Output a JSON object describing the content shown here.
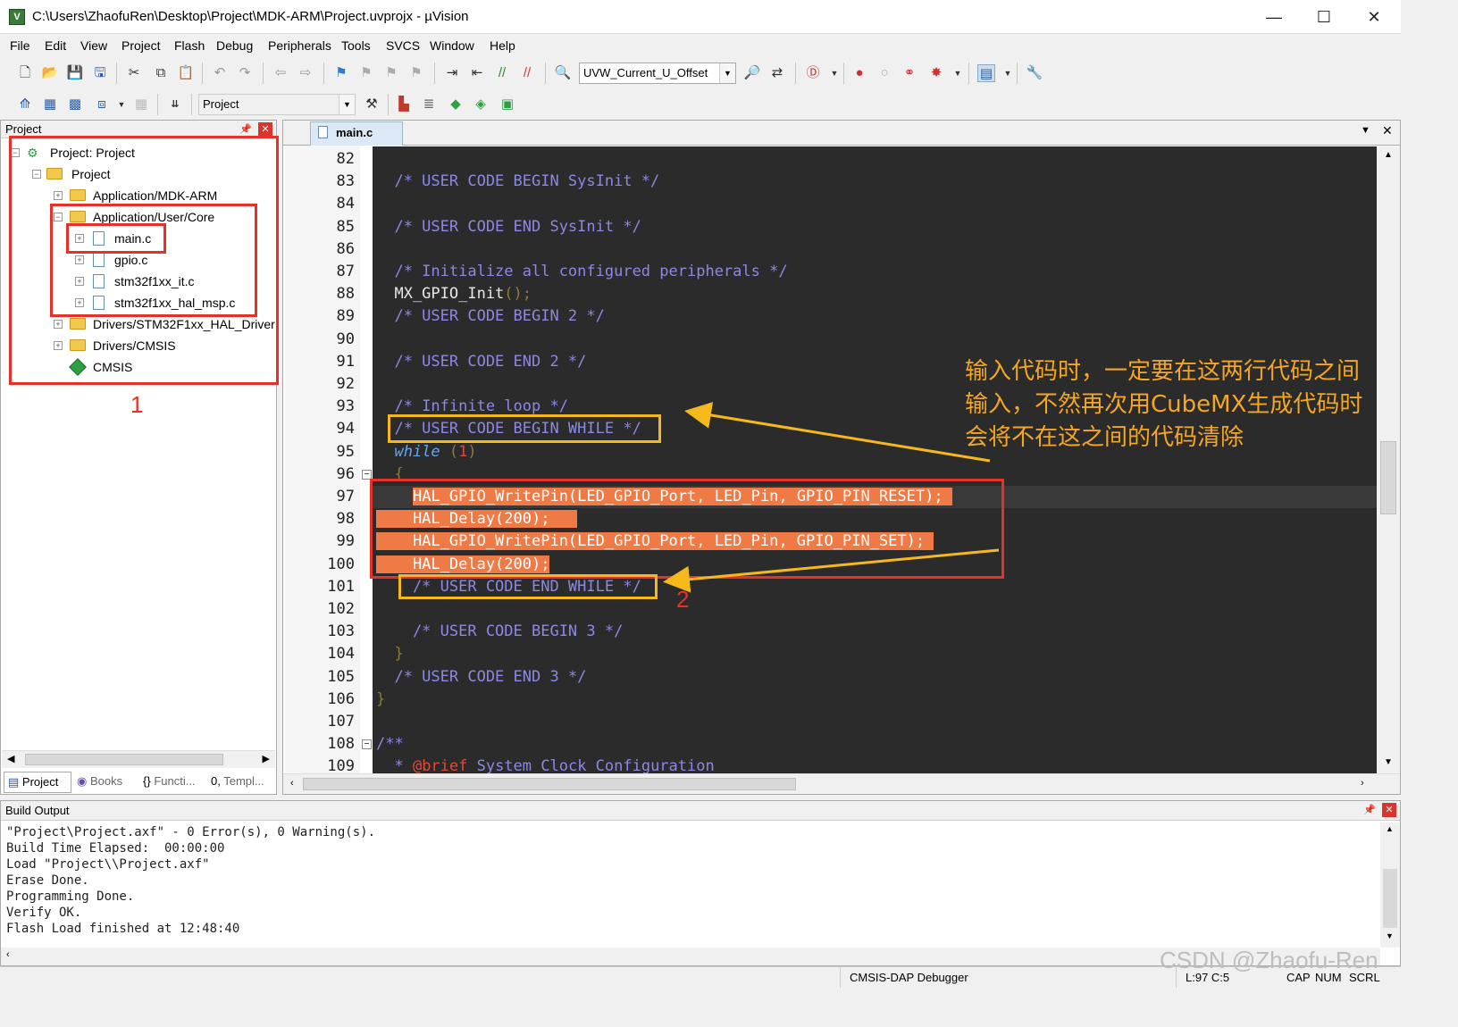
{
  "window": {
    "title": "C:\\Users\\ZhaofuRen\\Desktop\\Project\\MDK-ARM\\Project.uvprojx - µVision",
    "minimize": "—",
    "maximize": "☐",
    "close": "✕"
  },
  "menu": [
    "File",
    "Edit",
    "View",
    "Project",
    "Flash",
    "Debug",
    "Peripherals",
    "Tools",
    "SVCS",
    "Window",
    "Help"
  ],
  "toolbar": {
    "find_combo": "UVW_Current_U_Offset",
    "target_combo": "Project"
  },
  "project_panel": {
    "title": "Project",
    "tree": {
      "root": "Project: Project",
      "target": "Project",
      "groups": [
        {
          "label": "Application/MDK-ARM"
        },
        {
          "label": "Application/User/Core",
          "files": [
            "main.c",
            "gpio.c",
            "stm32f1xx_it.c",
            "stm32f1xx_hal_msp.c"
          ]
        },
        {
          "label": "Drivers/STM32F1xx_HAL_Driver"
        },
        {
          "label": "Drivers/CMSIS"
        },
        {
          "label": "CMSIS"
        }
      ]
    },
    "tabs": [
      "Project",
      "Books",
      "Functi...",
      "Templ..."
    ]
  },
  "editor": {
    "tab": "main.c",
    "lines": [
      {
        "n": "82",
        "tokens": []
      },
      {
        "n": "83",
        "tokens": [
          {
            "c": "cm",
            "t": "  /* USER CODE BEGIN SysInit */"
          }
        ]
      },
      {
        "n": "84",
        "tokens": []
      },
      {
        "n": "85",
        "tokens": [
          {
            "c": "cm",
            "t": "  /* USER CODE END SysInit */"
          }
        ]
      },
      {
        "n": "86",
        "tokens": []
      },
      {
        "n": "87",
        "tokens": [
          {
            "c": "cm",
            "t": "  /* Initialize all configured peripherals */"
          }
        ]
      },
      {
        "n": "88",
        "tokens": [
          {
            "c": "",
            "t": "  MX_GPIO_Init"
          },
          {
            "c": "par",
            "t": "();"
          }
        ]
      },
      {
        "n": "89",
        "tokens": [
          {
            "c": "cm",
            "t": "  /* USER CODE BEGIN 2 */"
          }
        ]
      },
      {
        "n": "90",
        "tokens": []
      },
      {
        "n": "91",
        "tokens": [
          {
            "c": "cm",
            "t": "  /* USER CODE END 2 */"
          }
        ]
      },
      {
        "n": "92",
        "tokens": []
      },
      {
        "n": "93",
        "tokens": [
          {
            "c": "cm",
            "t": "  /* Infinite loop */"
          }
        ]
      },
      {
        "n": "94",
        "tokens": [
          {
            "c": "cm",
            "t": "  /* USER CODE BEGIN WHILE */"
          }
        ]
      },
      {
        "n": "95",
        "tokens": [
          {
            "c": "kw",
            "t": "  while"
          },
          {
            "c": "par",
            "t": " ("
          },
          {
            "c": "num",
            "t": "1"
          },
          {
            "c": "par",
            "t": ")"
          }
        ]
      },
      {
        "n": "96",
        "tokens": [
          {
            "c": "par",
            "t": "  {"
          }
        ]
      },
      {
        "n": "97",
        "tokens": [
          {
            "c": "",
            "t": "    "
          },
          {
            "c": "hl",
            "t": "HAL_GPIO_WritePin(LED_GPIO_Port, LED_Pin, GPIO_PIN_RESET); "
          }
        ]
      },
      {
        "n": "98",
        "tokens": [
          {
            "c": "hl",
            "t": "    HAL_Delay(200);   "
          }
        ]
      },
      {
        "n": "99",
        "tokens": [
          {
            "c": "hl",
            "t": "    HAL_GPIO_WritePin(LED_GPIO_Port, LED_Pin, GPIO_PIN_SET); "
          }
        ]
      },
      {
        "n": "100",
        "tokens": [
          {
            "c": "hl",
            "t": "    HAL_Delay(200);"
          }
        ]
      },
      {
        "n": "101",
        "tokens": [
          {
            "c": "cm",
            "t": "    /* USER CODE END WHILE */"
          }
        ]
      },
      {
        "n": "102",
        "tokens": []
      },
      {
        "n": "103",
        "tokens": [
          {
            "c": "cm",
            "t": "    /* USER CODE BEGIN 3 */"
          }
        ]
      },
      {
        "n": "104",
        "tokens": [
          {
            "c": "par",
            "t": "  }"
          }
        ]
      },
      {
        "n": "105",
        "tokens": [
          {
            "c": "cm",
            "t": "  /* USER CODE END 3 */"
          }
        ]
      },
      {
        "n": "106",
        "tokens": [
          {
            "c": "par",
            "t": "}"
          }
        ]
      },
      {
        "n": "107",
        "tokens": []
      },
      {
        "n": "108",
        "tokens": [
          {
            "c": "cm",
            "t": "/**"
          }
        ]
      },
      {
        "n": "109",
        "tokens": [
          {
            "c": "cm",
            "t": "  * "
          },
          {
            "c": "num",
            "t": "@brief"
          },
          {
            "c": "cm",
            "t": " System Clock Configuration"
          }
        ]
      }
    ]
  },
  "annotations": {
    "note_lines": [
      "输入代码时，一定要在这两行代码之间",
      "输入，不然再次用CubeMX生成代码时",
      "会将不在这之间的代码清除"
    ],
    "label1": "1",
    "label2": "2"
  },
  "build_output": {
    "title": "Build Output",
    "lines": [
      "\"Project\\Project.axf\" - 0 Error(s), 0 Warning(s).",
      "Build Time Elapsed:  00:00:00",
      "Load \"Project\\\\Project.axf\"",
      "Erase Done.",
      "Programming Done.",
      "Verify OK.",
      "Flash Load finished at 12:48:40"
    ]
  },
  "status": {
    "debugger": "CMSIS-DAP Debugger",
    "position": "L:97 C:5",
    "caps": "CAP",
    "num": "NUM",
    "scrl": "SCRL"
  },
  "watermark": "CSDN @Zhaofu-Ren",
  "colors": {
    "editor_bg": "#2b2b2b",
    "comment": "#8c88e6",
    "keyword": "#62a8f0",
    "selection": "#f07a45",
    "annotation_red": "#e8302a",
    "annotation_yellow": "#f5b91c",
    "note_text": "#f5a623"
  }
}
